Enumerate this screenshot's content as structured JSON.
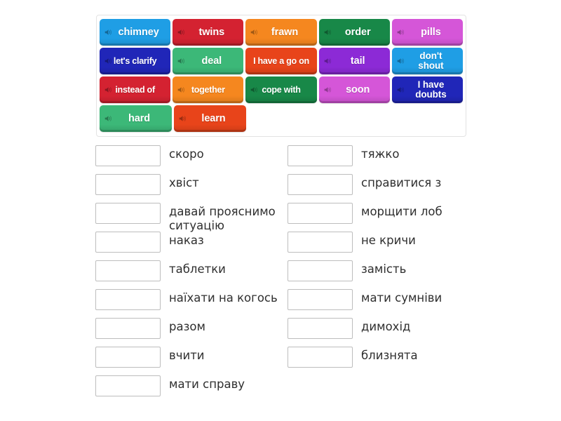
{
  "tiles": {
    "rows": [
      [
        {
          "label": "chimney",
          "color": "#1f9ee5",
          "icon": "speaker-icon",
          "size": "normal"
        },
        {
          "label": "twins",
          "color": "#d42231",
          "icon": "speaker-icon",
          "size": "normal"
        },
        {
          "label": "frawn",
          "color": "#f5871f",
          "icon": "speaker-icon",
          "size": "normal"
        },
        {
          "label": "order",
          "color": "#188848",
          "icon": "speaker-icon",
          "size": "normal"
        },
        {
          "label": "pills",
          "color": "#d556d8",
          "icon": "speaker-icon",
          "size": "normal"
        }
      ],
      [
        {
          "label": "let's clarify",
          "color": "#2026b8",
          "icon": "speaker-icon",
          "size": "small"
        },
        {
          "label": "deal",
          "color": "#3cb878",
          "icon": "speaker-icon",
          "size": "normal"
        },
        {
          "label": "I have a go on",
          "color": "#e8441a",
          "icon": "none",
          "size": "small"
        },
        {
          "label": "tail",
          "color": "#8c2ad6",
          "icon": "speaker-icon",
          "size": "normal"
        },
        {
          "label": "don't\nshout",
          "color": "#1f9ee5",
          "icon": "speaker-icon",
          "size": "two-line"
        }
      ],
      [
        {
          "label": "instead of",
          "color": "#d42231",
          "icon": "speaker-icon",
          "size": "small"
        },
        {
          "label": "together",
          "color": "#f5871f",
          "icon": "speaker-icon",
          "size": "small"
        },
        {
          "label": "cope with",
          "color": "#188848",
          "icon": "speaker-icon",
          "size": "small"
        },
        {
          "label": "soon",
          "color": "#d556d8",
          "icon": "speaker-icon",
          "size": "normal"
        },
        {
          "label": "I have\ndoubts",
          "color": "#2026b8",
          "icon": "speaker-icon",
          "size": "two-line"
        }
      ],
      [
        {
          "label": "hard",
          "color": "#3cb878",
          "icon": "speaker-icon",
          "size": "normal"
        },
        {
          "label": "learn",
          "color": "#e8441a",
          "icon": "speaker-icon",
          "size": "normal"
        }
      ]
    ]
  },
  "answers": {
    "left": [
      {
        "box_value": "",
        "text": "скоро"
      },
      {
        "box_value": "",
        "text": "хвіст"
      },
      {
        "box_value": "",
        "text": "давай прояснимо ситуацію"
      },
      {
        "box_value": "",
        "text": "наказ"
      },
      {
        "box_value": "",
        "text": "таблетки"
      },
      {
        "box_value": "",
        "text": "наїхати на когось"
      },
      {
        "box_value": "",
        "text": "разом"
      },
      {
        "box_value": "",
        "text": "вчити"
      },
      {
        "box_value": "",
        "text": "мати справу"
      }
    ],
    "right": [
      {
        "box_value": "",
        "text": "тяжко"
      },
      {
        "box_value": "",
        "text": "справитися з"
      },
      {
        "box_value": "",
        "text": "морщити лоб"
      },
      {
        "box_value": "",
        "text": "не кричи"
      },
      {
        "box_value": "",
        "text": "замість"
      },
      {
        "box_value": "",
        "text": "мати сумніви"
      },
      {
        "box_value": "",
        "text": "димохід"
      },
      {
        "box_value": "",
        "text": "близнята"
      }
    ]
  },
  "colors": {
    "page_background": "#ffffff",
    "panel_border": "#e3e3e3",
    "box_border": "#bdbdbd",
    "text": "#2f2f2f"
  }
}
